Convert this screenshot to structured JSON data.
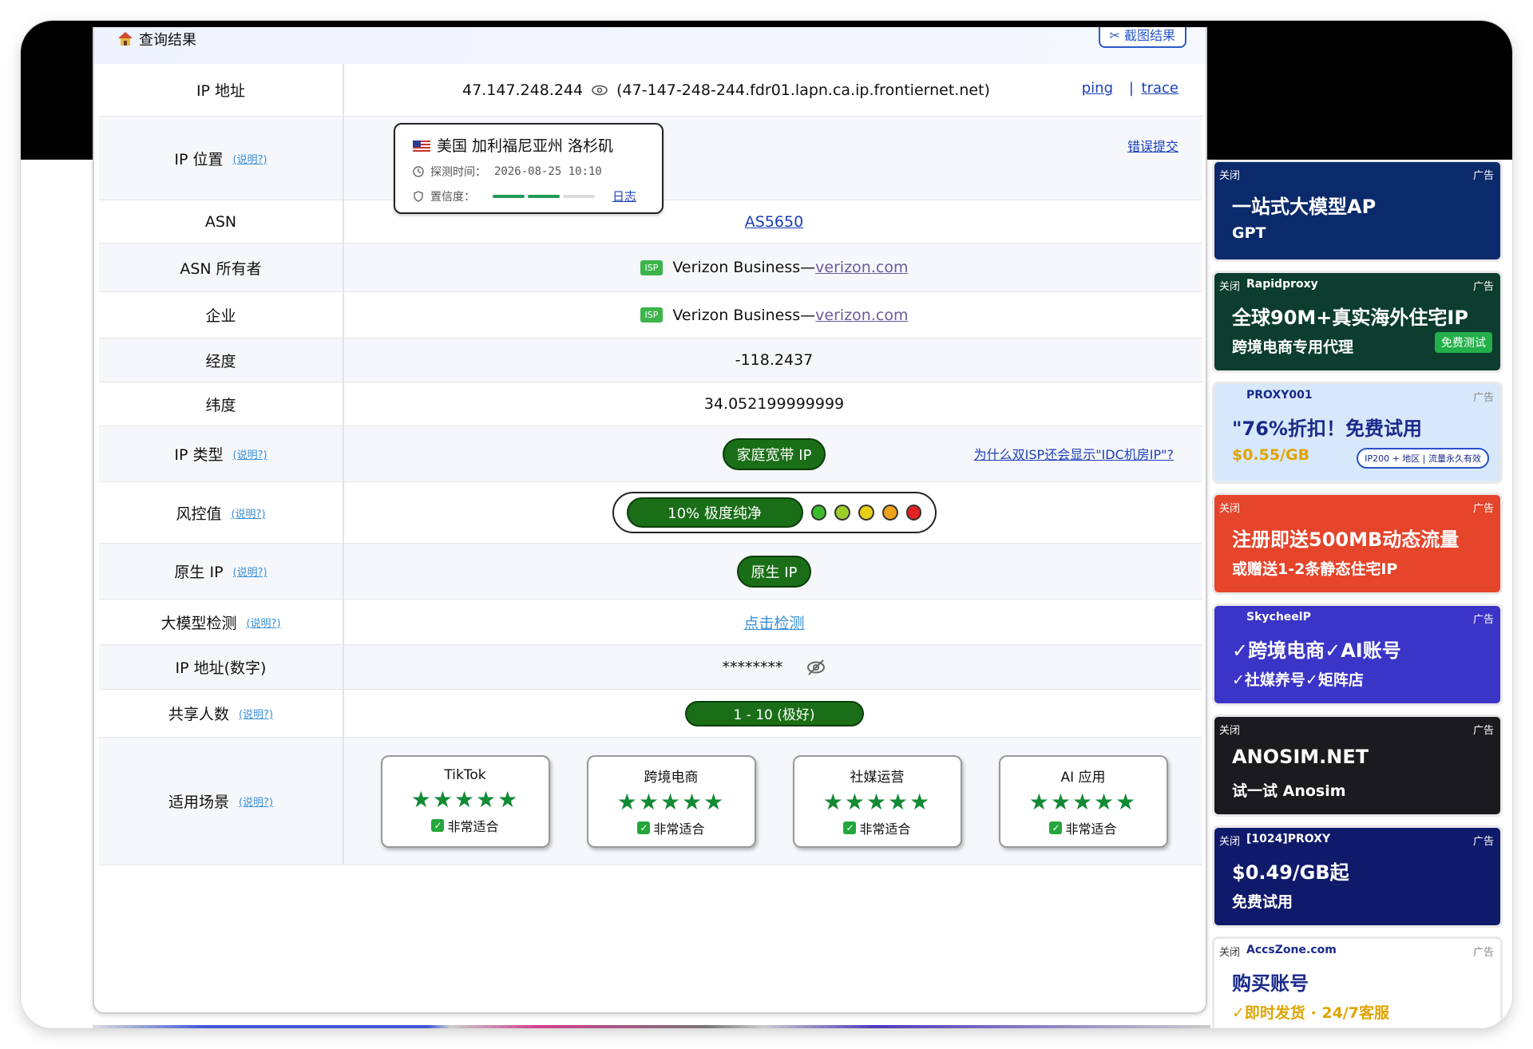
{
  "header": {
    "title": "查询结果",
    "screenshot_button": "✂ 截图结果"
  },
  "ip": {
    "label": "IP 地址",
    "address": "47.147.248.244",
    "hostname": "(47-147-248-244.fdr01.lapn.ca.ip.frontiernet.net)",
    "ping": "ping",
    "sep": "|",
    "trace": "trace"
  },
  "location": {
    "label": "IP 位置",
    "help": "(说明?)",
    "place": "美国 加利福尼亚州 洛杉矶",
    "time_label": "探测时间：",
    "time_value": "2026-08-25 10:10",
    "conf_label": "置信度：",
    "log": "日志",
    "report": "错误提交",
    "confidence": 0.67
  },
  "asn": {
    "label": "ASN",
    "value": "AS5650"
  },
  "asn_owner": {
    "label": "ASN 所有者",
    "badge": "ISP",
    "name": "Verizon Business—",
    "domain": "verizon.com"
  },
  "company": {
    "label": "企业",
    "badge": "ISP",
    "name": "Verizon Business—",
    "domain": "verizon.com"
  },
  "longitude": {
    "label": "经度",
    "value": "-118.2437"
  },
  "latitude": {
    "label": "纬度",
    "value": "34.052199999999"
  },
  "ip_type": {
    "label": "IP 类型",
    "help": "(说明?)",
    "value": "家庭宽带 IP",
    "link": "为什么双ISP还会显示\"IDC机房IP\"?"
  },
  "risk": {
    "label": "风控值",
    "help": "(说明?)",
    "value": "10%  极度纯净",
    "dots": [
      "#3dbb2e",
      "#9ccc2a",
      "#e7cf17",
      "#f0a21c",
      "#e32222"
    ]
  },
  "native": {
    "label": "原生 IP",
    "help": "(说明?)",
    "value": "原生 IP"
  },
  "llm": {
    "label": "大模型检测",
    "help": "(说明?)",
    "value": "点击检测"
  },
  "ip_numeric": {
    "label": "IP 地址(数字)",
    "value": "********"
  },
  "shared": {
    "label": "共享人数",
    "help": "(说明?)",
    "value": "1 - 10 (极好)"
  },
  "scenes": {
    "label": "适用场景",
    "help": "(说明?)",
    "stars": "★★★★★",
    "items": [
      {
        "name": "TikTok",
        "status": "非常适合"
      },
      {
        "name": "跨境电商",
        "status": "非常适合"
      },
      {
        "name": "社媒运营",
        "status": "非常适合"
      },
      {
        "name": "AI 应用",
        "status": "非常适合"
      }
    ]
  },
  "ads": [
    {
      "close": "关闭",
      "tag": "广告",
      "text": "一站式大模型AP",
      "sub": "GPT",
      "bg": "#0b2a6b"
    },
    {
      "close": "关闭",
      "tag": "广告",
      "text": "全球90M+真实海外住宅IP",
      "sub": "跨境电商专用代理",
      "brand": "Rapidproxy",
      "btn": "免费测试",
      "bg": "#0c3d2e"
    },
    {
      "close": "",
      "tag": "广告",
      "text": "\"76%折扣！免费试用",
      "sub": "$0.55/GB",
      "brand": "PROXY001",
      "extra": "IP200 + 地区 | 流量永久有效",
      "bg": "#d8e8fb"
    },
    {
      "close": "关闭",
      "tag": "广告",
      "text": "注册即送500MB动态流量",
      "sub": "或赠送1-2条静态住宅IP",
      "bg": "#e5452b"
    },
    {
      "close": "",
      "tag": "广告",
      "text": "✓跨境电商✓AI账号",
      "sub": "✓社媒养号✓矩阵店",
      "brand": "SkycheelP",
      "bg": "#3a34c7"
    },
    {
      "close": "关闭",
      "tag": "广告",
      "text": "ANOSIM.NET",
      "sub": "试一试 Anosim",
      "bg": "#1a1a1f"
    },
    {
      "close": "关闭",
      "tag": "广告",
      "text": "$0.49/GB起",
      "sub": "免费试用",
      "brand": "[1024]PROXY",
      "bg": "#101a6b"
    },
    {
      "close": "关闭",
      "tag": "广告",
      "text": "购买账号",
      "sub": "✓即时发货 · 24/7客服",
      "brand": "AccsZone.com",
      "bg": "#ffffff"
    }
  ]
}
